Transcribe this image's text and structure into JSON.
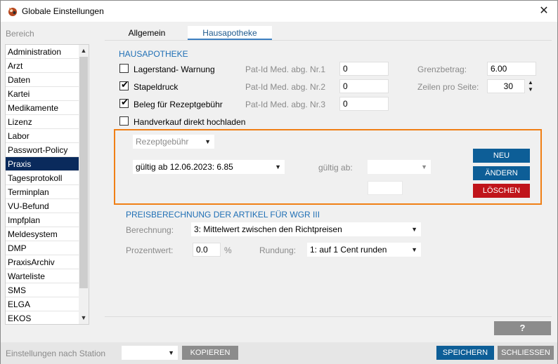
{
  "window": {
    "title": "Globale Einstellungen"
  },
  "sidebar": {
    "label": "Bereich",
    "items": [
      {
        "label": "Administration"
      },
      {
        "label": "Arzt"
      },
      {
        "label": "Daten"
      },
      {
        "label": "Kartei"
      },
      {
        "label": "Medikamente"
      },
      {
        "label": "Lizenz"
      },
      {
        "label": "Labor"
      },
      {
        "label": "Passwort-Policy"
      },
      {
        "label": "Praxis"
      },
      {
        "label": "Tagesprotokoll"
      },
      {
        "label": "Terminplan"
      },
      {
        "label": "VU-Befund"
      },
      {
        "label": "Impfplan"
      },
      {
        "label": "Meldesystem"
      },
      {
        "label": "DMP"
      },
      {
        "label": "PraxisArchiv"
      },
      {
        "label": "Warteliste"
      },
      {
        "label": "SMS"
      },
      {
        "label": "ELGA"
      },
      {
        "label": "EKOS"
      }
    ],
    "active": "Praxis"
  },
  "tabs": [
    {
      "label": "Allgemein"
    },
    {
      "label": "Hausapotheke"
    }
  ],
  "hausapotheke": {
    "section_title": "HAUSAPOTHEKE",
    "lagerstand_warnung": {
      "label": "Lagerstand- Warnung",
      "checked": false
    },
    "stapeldruck": {
      "label": "Stapeldruck",
      "checked": true
    },
    "beleg_rezeptgebuehr": {
      "label": "Beleg für Rezeptgebühr",
      "checked": true
    },
    "handverkauf": {
      "label": "Handverkauf direkt hochladen",
      "checked": false
    },
    "check_glyph": "✔",
    "pat_id_1": {
      "label": "Pat-Id Med. abg. Nr.1",
      "value": "0"
    },
    "pat_id_2": {
      "label": "Pat-Id Med. abg. Nr.2",
      "value": "0"
    },
    "pat_id_3": {
      "label": "Pat-Id Med. abg. Nr.3",
      "value": "0"
    },
    "grenzbetrag": {
      "label": "Grenzbetrag:",
      "value": "6.00"
    },
    "zeilen_pro_seite": {
      "label": "Zeilen pro Seite:",
      "value": "30"
    }
  },
  "rezeptgebuehr": {
    "type_select": "Rezeptgebühr",
    "gueltig_select": "gültig ab 12.06.2023:  6.85",
    "gueltig_ab_label": "gültig ab:",
    "gueltig_ab_value": "",
    "amount_value": "",
    "buttons": {
      "neu": "NEU",
      "aendern": "ÄNDERN",
      "loeschen": "LÖSCHEN"
    }
  },
  "preisberechnung": {
    "title": "PREISBERECHNUNG DER ARTIKEL FÜR WGR III",
    "berechnung_label": "Berechnung:",
    "berechnung_value": "3: Mittelwert zwischen den Richtpreisen",
    "prozentwert_label": "Prozentwert:",
    "prozentwert_value": "0.0",
    "percent_sign": "%",
    "rundung_label": "Rundung:",
    "rundung_value": "1: auf  1 Cent runden"
  },
  "help_button": "?",
  "footer": {
    "station_label": "Einstellungen nach Station",
    "station_value": "",
    "kopieren": "KOPIEREN",
    "speichern": "SPEICHERN",
    "schliessen": "SCHLIESSEN"
  },
  "colors": {
    "accent_blue": "#0d5e97",
    "delete_red": "#c0141a",
    "highlight_orange": "#f07f15",
    "active_nav": "#0a2a5c",
    "section_title": "#1f6fb5"
  }
}
